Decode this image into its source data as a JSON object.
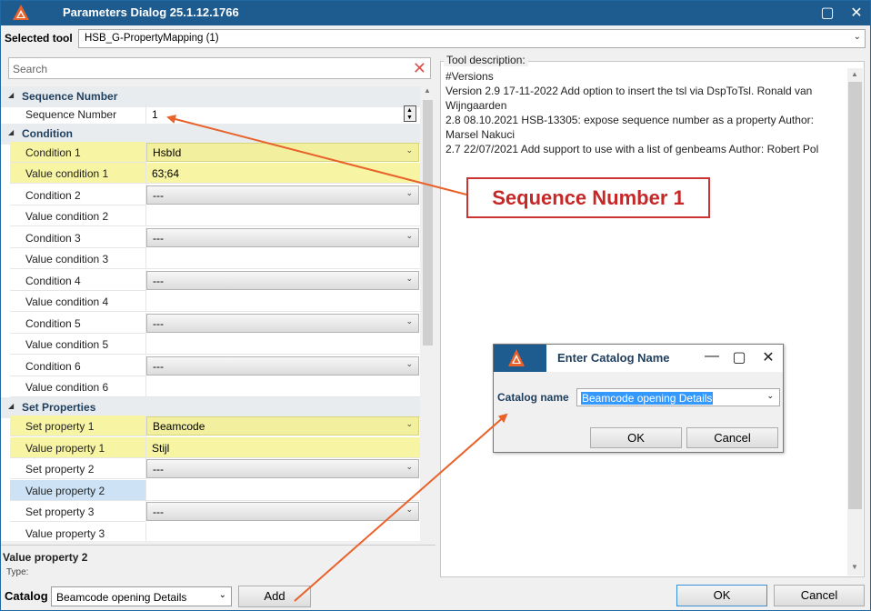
{
  "window": {
    "title": "Parameters Dialog 25.1.12.1766"
  },
  "selected_tool": {
    "label": "Selected tool",
    "value": "HSB_G-PropertyMapping (1)"
  },
  "search": {
    "placeholder": "Search"
  },
  "categories": {
    "sequence": "Sequence Number",
    "condition": "Condition",
    "set_properties": "Set Properties"
  },
  "properties": {
    "sequence_number": {
      "name": "Sequence Number",
      "value": "1"
    },
    "condition_1": {
      "name": "Condition 1",
      "value": "HsbId"
    },
    "value_condition_1": {
      "name": "Value condition 1",
      "value": "63;64"
    },
    "condition_2": {
      "name": "Condition 2",
      "value": "---"
    },
    "value_condition_2": {
      "name": "Value condition 2",
      "value": ""
    },
    "condition_3": {
      "name": "Condition 3",
      "value": "---"
    },
    "value_condition_3": {
      "name": "Value condition 3",
      "value": ""
    },
    "condition_4": {
      "name": "Condition 4",
      "value": "---"
    },
    "value_condition_4": {
      "name": "Value condition 4",
      "value": ""
    },
    "condition_5": {
      "name": "Condition 5",
      "value": "---"
    },
    "value_condition_5": {
      "name": "Value condition 5",
      "value": ""
    },
    "condition_6": {
      "name": "Condition 6",
      "value": "---"
    },
    "value_condition_6": {
      "name": "Value condition 6",
      "value": ""
    },
    "set_property_1": {
      "name": "Set property 1",
      "value": "Beamcode"
    },
    "value_property_1": {
      "name": "Value property 1",
      "value": "Stijl"
    },
    "set_property_2": {
      "name": "Set property 2",
      "value": "---"
    },
    "value_property_2": {
      "name": "Value property 2",
      "value": ""
    },
    "set_property_3": {
      "name": "Set property 3",
      "value": "---"
    },
    "value_property_3": {
      "name": "Value property 3",
      "value": ""
    }
  },
  "help": {
    "title": "Value property 2",
    "subtitle": "Type:"
  },
  "description": {
    "label": "Tool description:",
    "text": "#Versions\nVersion 2.9 17-11-2022 Add option to insert the tsl via DspToTsl. Ronald van Wijngaarden\n2.8 08.10.2021 HSB-13305: expose sequence number as a property Author: Marsel Nakuci\n2.7 22/07/2021 Add support to use with a list of genbeams Author: Robert Pol"
  },
  "catalog": {
    "label": "Catalog",
    "value": "Beamcode opening Details",
    "add_label": "Add"
  },
  "buttons": {
    "ok": "OK",
    "cancel": "Cancel"
  },
  "catalog_dialog": {
    "title": "Enter Catalog Name",
    "label": "Catalog name",
    "value": "Beamcode opening Details",
    "ok": "OK",
    "cancel": "Cancel"
  },
  "annotation": {
    "text": "Sequence Number 1"
  },
  "colors": {
    "titlebar": "#1e5b8e",
    "highlight": "#f7f4a3",
    "selection": "#cde3f5",
    "annotation_red": "#c62828",
    "arrow": "#e8622a"
  },
  "icons": [
    "app-logo-icon",
    "minimize-icon",
    "maximize-icon",
    "close-icon",
    "clear-search-icon",
    "chevron-down-icon",
    "collapse-triangle-icon",
    "stepper-icon"
  ]
}
